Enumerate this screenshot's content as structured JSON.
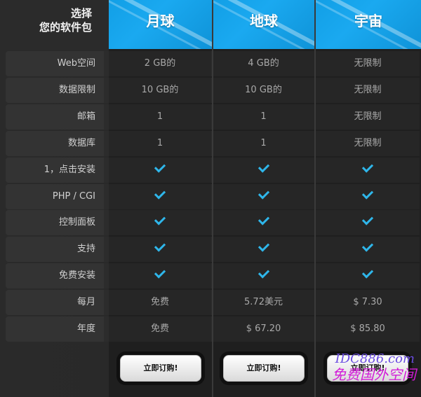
{
  "header": {
    "corner_line1": "选择",
    "corner_line2": "您的软件包",
    "plans": [
      "月球",
      "地球",
      "宇宙"
    ]
  },
  "rows": [
    {
      "label": "Web空间",
      "values": [
        "2 GB的",
        "4 GB的",
        "无限制"
      ],
      "check": false
    },
    {
      "label": "数据限制",
      "values": [
        "10 GB的",
        "10 GB的",
        "无限制"
      ],
      "check": false
    },
    {
      "label": "邮箱",
      "values": [
        "1",
        "1",
        "无限制"
      ],
      "check": false
    },
    {
      "label": "数据库",
      "values": [
        "1",
        "1",
        "无限制"
      ],
      "check": false
    },
    {
      "label": "1，点击安装",
      "values": [
        "",
        "",
        ""
      ],
      "check": true
    },
    {
      "label": "PHP / CGI",
      "values": [
        "",
        "",
        ""
      ],
      "check": true
    },
    {
      "label": "控制面板",
      "values": [
        "",
        "",
        ""
      ],
      "check": true
    },
    {
      "label": "支持",
      "values": [
        "",
        "",
        ""
      ],
      "check": true
    },
    {
      "label": "免费安装",
      "values": [
        "",
        "",
        ""
      ],
      "check": true
    },
    {
      "label": "每月",
      "values": [
        "免费",
        "5.72美元",
        "$ 7.30"
      ],
      "check": false
    },
    {
      "label": "年度",
      "values": [
        "免费",
        "$ 67.20",
        "$ 85.80"
      ],
      "check": false
    }
  ],
  "buttons": {
    "order_label": "立即订购!"
  },
  "watermark": {
    "line1": "IDC886.com",
    "line2": "免费国外空间"
  },
  "colors": {
    "header_blue": "#1aa9f0",
    "check_blue": "#2fb6ea"
  }
}
